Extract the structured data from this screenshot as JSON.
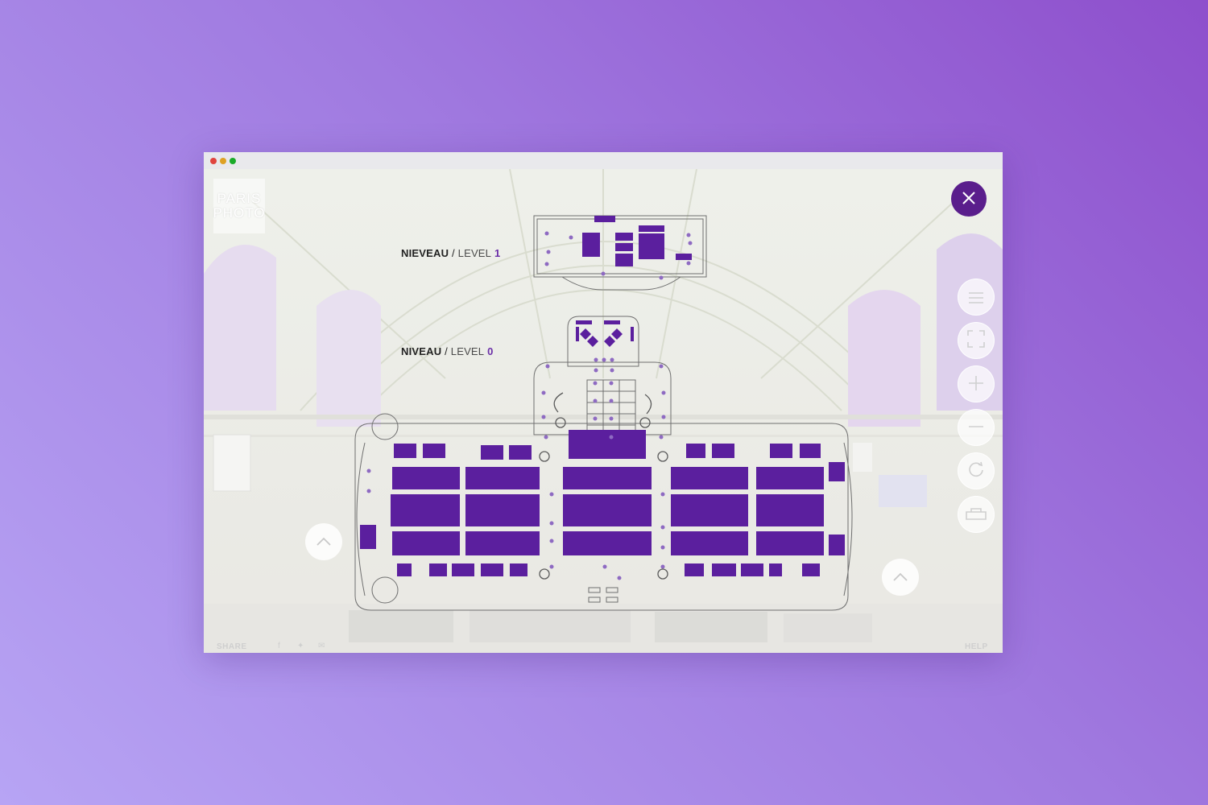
{
  "window": {
    "controls": [
      "close",
      "minimize",
      "maximize"
    ]
  },
  "brand": {
    "logo_line1": "PARIS",
    "logo_line2": "PHOTO"
  },
  "floorplan": {
    "level1": {
      "prefix": "NIEVEAU",
      "sep": "/",
      "level_word": "LEVEL",
      "num": "1"
    },
    "level0": {
      "prefix": "NIVEAU",
      "sep": "/",
      "level_word": "LEVEL",
      "num": "0"
    },
    "booth_color": "#5b1f9e",
    "marker_color": "#8e6ac2"
  },
  "controls": {
    "close_icon": "close-icon",
    "items": [
      {
        "name": "menu-icon"
      },
      {
        "name": "fullscreen-icon"
      },
      {
        "name": "zoom-in-icon"
      },
      {
        "name": "zoom-out-icon"
      },
      {
        "name": "rotate-icon"
      },
      {
        "name": "vr-headset-icon"
      }
    ]
  },
  "footer": {
    "share_label": "SHARE",
    "help_label": "HELP"
  }
}
